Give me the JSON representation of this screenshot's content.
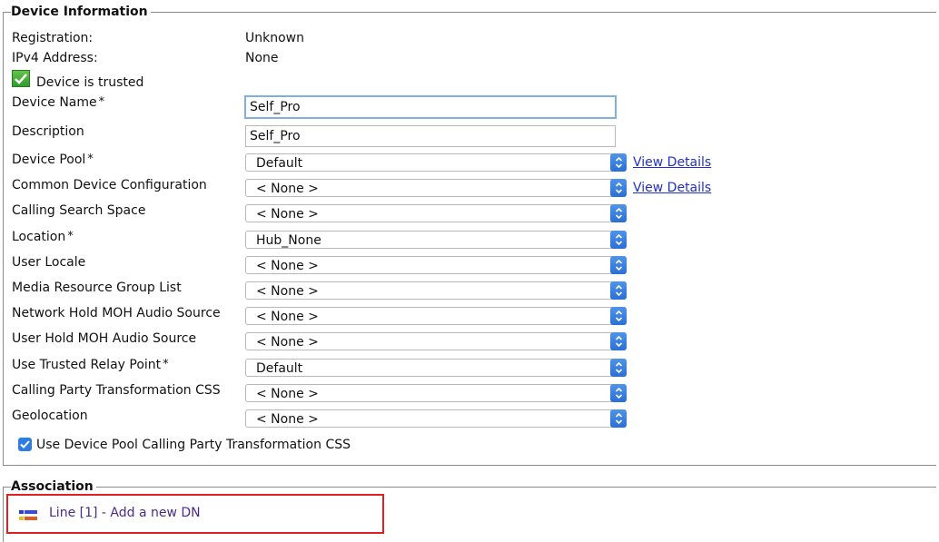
{
  "device_info": {
    "legend": "Device Information",
    "registration": {
      "label": "Registration:",
      "value": "Unknown"
    },
    "ipv4": {
      "label": "IPv4 Address:",
      "value": "None"
    },
    "trusted_label": "Device is trusted",
    "device_name": {
      "label": "Device Name",
      "value": "Self_Pro"
    },
    "description": {
      "label": "Description",
      "value": "Self_Pro"
    },
    "required_mark": "*",
    "view_details": "View Details",
    "fields": [
      {
        "label": "Device Pool",
        "value": "Default"
      },
      {
        "label": "Common Device Configuration",
        "value": "< None >"
      },
      {
        "label": "Calling Search Space",
        "value": "< None >"
      },
      {
        "label": "Location",
        "value": "Hub_None"
      },
      {
        "label": "User Locale",
        "value": "< None >"
      },
      {
        "label": "Media Resource Group List",
        "value": "< None >"
      },
      {
        "label": "Network Hold MOH Audio Source",
        "value": "< None >"
      },
      {
        "label": "User Hold MOH Audio Source",
        "value": "< None >"
      },
      {
        "label": "Use Trusted Relay Point",
        "value": "Default"
      },
      {
        "label": "Calling Party Transformation CSS",
        "value": "< None >"
      },
      {
        "label": "Geolocation",
        "value": "< None >"
      }
    ],
    "use_pool_css_label": "Use Device Pool Calling Party Transformation CSS"
  },
  "association": {
    "legend": "Association",
    "line_link": "Line [1] - Add a new DN"
  },
  "colors": {
    "link": "#2030c8",
    "highlight_border": "#e02020",
    "select_arrow": "#2a6fd6"
  }
}
